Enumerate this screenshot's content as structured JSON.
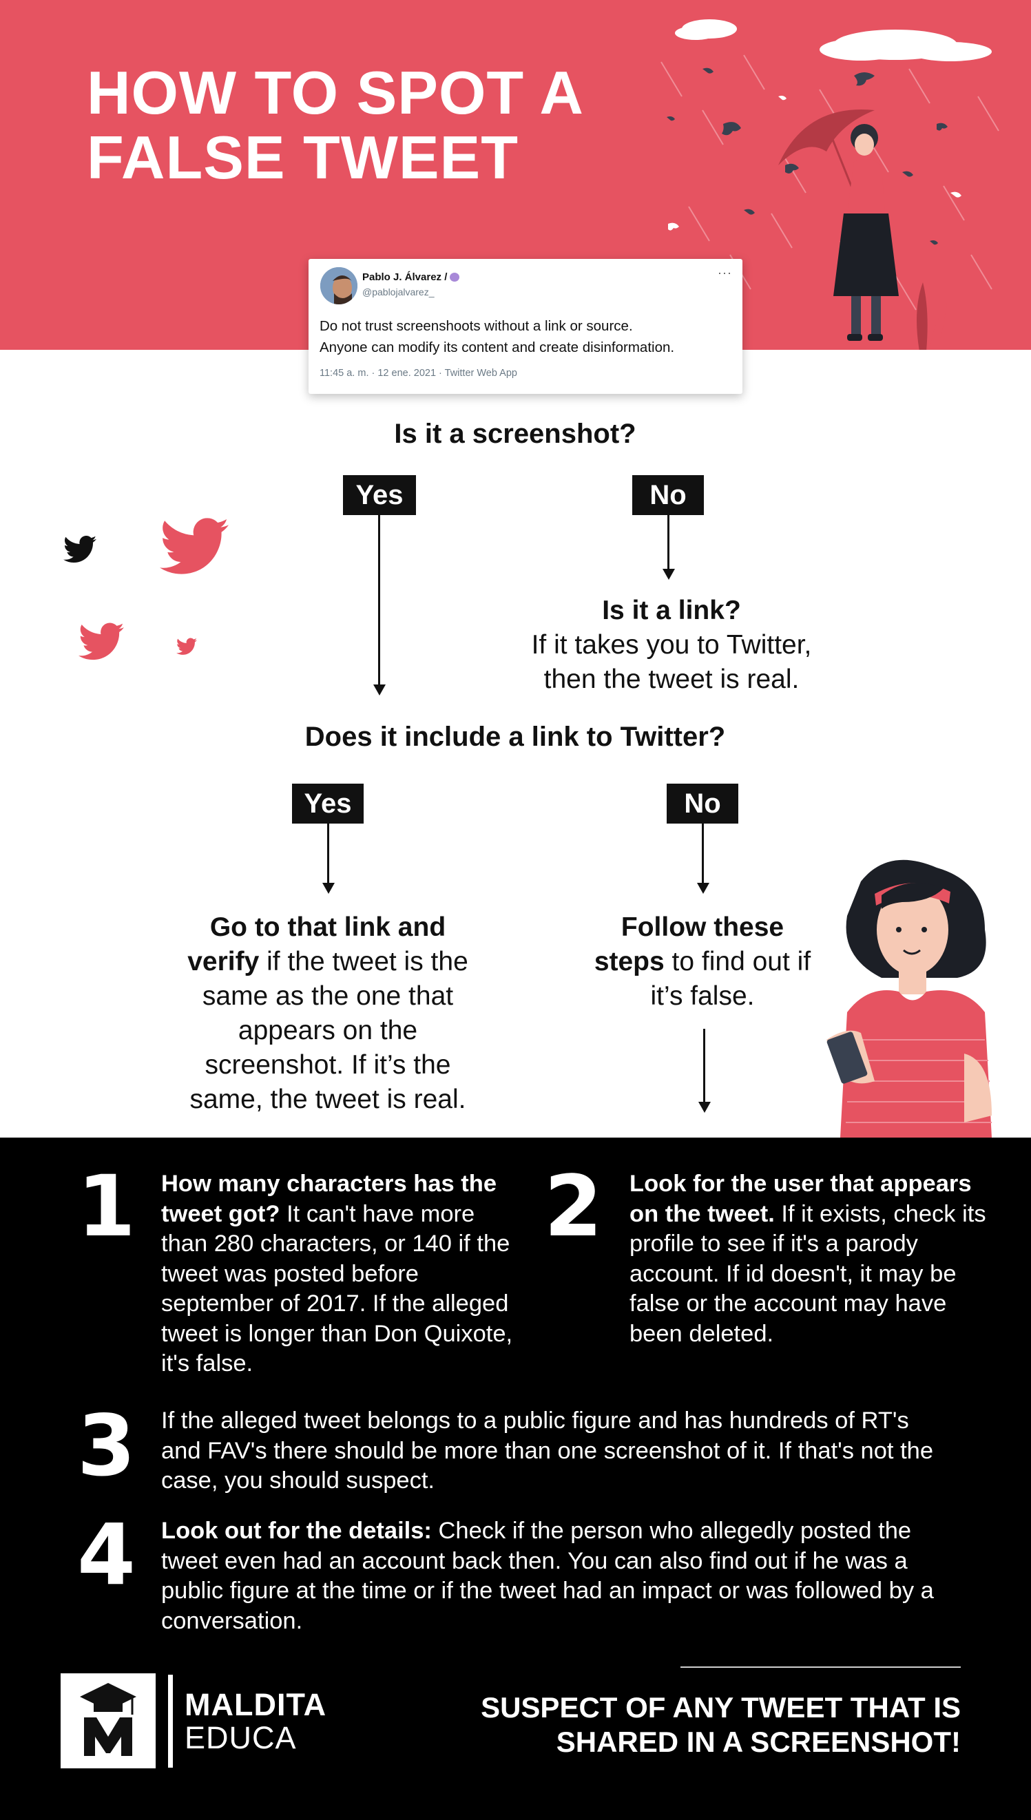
{
  "header": {
    "title_line1": "HOW TO SPOT A",
    "title_line2": "FALSE TWEET"
  },
  "tweet": {
    "name": "Pablo J. Álvarez /",
    "handle": "@pablojalvarez_",
    "menu": "···",
    "body_line1": "Do not trust screenshoots without a link or source.",
    "body_line2": "Anyone can modify its content and create disinformation.",
    "meta": "11:45 a. m. · 12 ene. 2021 · Twitter Web App"
  },
  "flow": {
    "q1": "Is it a screenshot?",
    "yes1": "Yes",
    "no1": "No",
    "link_title": "Is it a link?",
    "link_line1": "If it takes you to Twitter,",
    "link_line2": "then the tweet is real.",
    "q2": "Does it include a link to Twitter?",
    "yes2": "Yes",
    "no2": "No",
    "verify_bold1": "Go to that link and",
    "verify_bold2": "verify",
    "verify_rest1": " if the tweet is the",
    "verify_l3": "same as the one that",
    "verify_l4": "appears on the",
    "verify_l5": "screenshot. If it’s the",
    "verify_l6": "same, the tweet is real.",
    "follow_bold1": "Follow these",
    "follow_bold2": "steps",
    "follow_rest": " to find out if",
    "follow_l3": "it’s false."
  },
  "steps": [
    {
      "num": "1",
      "bold": "How many characters has the tweet got?",
      "text": " It can't have more than 280 characters, or 140 if the tweet was posted before september of 2017. If the alleged tweet is longer than Don Quixote, it's false."
    },
    {
      "num": "2",
      "bold": "Look for the user that appears on the tweet.",
      "text": " If it exists, check its profile to see if it's a parody account. If id doesn't, it may be false or the account may have been deleted."
    },
    {
      "num": "3",
      "bold": "",
      "text": "If the alleged tweet belongs to a public figure and has hundreds of RT's and FAV's there should be more than one screenshot of it. If that's not the case, you should suspect."
    },
    {
      "num": "4",
      "bold": "Look out for the details:",
      "text": " Check if the person who allegedly posted the tweet even had an account back then. You can also find out if he was a public figure at the time or if the tweet had an impact or was followed by a conversation."
    }
  ],
  "footer": {
    "brand_line1": "MALDITA",
    "brand_line2": "EDUCA",
    "slogan_line1": "SUSPECT OF ANY TWEET THAT IS",
    "slogan_line2": "SHARED IN A SCREENSHOT!"
  },
  "colors": {
    "brand_red": "#e65361",
    "black": "#000000",
    "white": "#ffffff"
  }
}
